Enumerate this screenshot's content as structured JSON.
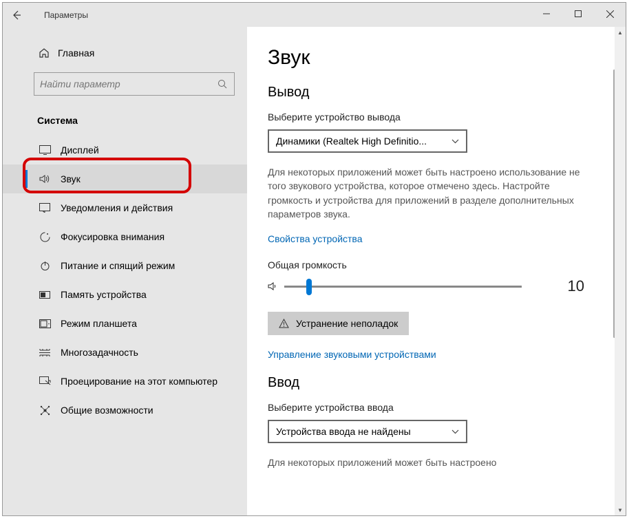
{
  "titlebar": {
    "title": "Параметры"
  },
  "sidebar": {
    "home_label": "Главная",
    "search_placeholder": "Найти параметр",
    "section_title": "Система",
    "items": [
      {
        "label": "Дисплей"
      },
      {
        "label": "Звук"
      },
      {
        "label": "Уведомления и действия"
      },
      {
        "label": "Фокусировка внимания"
      },
      {
        "label": "Питание и спящий режим"
      },
      {
        "label": "Память устройства"
      },
      {
        "label": "Режим планшета"
      },
      {
        "label": "Многозадачность"
      },
      {
        "label": "Проецирование на этот компьютер"
      },
      {
        "label": "Общие возможности"
      }
    ]
  },
  "content": {
    "page_title": "Звук",
    "output": {
      "heading": "Вывод",
      "select_label": "Выберите устройство вывода",
      "device_selected": "Динамики (Realtek High Definitio...",
      "description": "Для некоторых приложений может быть настроено использование не того звукового устройства, которое отмечено здесь. Настройте громкость и устройства для приложений в разделе дополнительных параметров звука.",
      "device_props_link": "Свойства устройства",
      "volume_label": "Общая громкость",
      "volume_value": "10",
      "troubleshoot_label": "Устранение неполадок",
      "manage_link": "Управление звуковыми устройствами"
    },
    "input": {
      "heading": "Ввод",
      "select_label": "Выберите устройства ввода",
      "device_selected": "Устройства ввода не найдены",
      "description": "Для некоторых приложений может быть настроено"
    }
  }
}
